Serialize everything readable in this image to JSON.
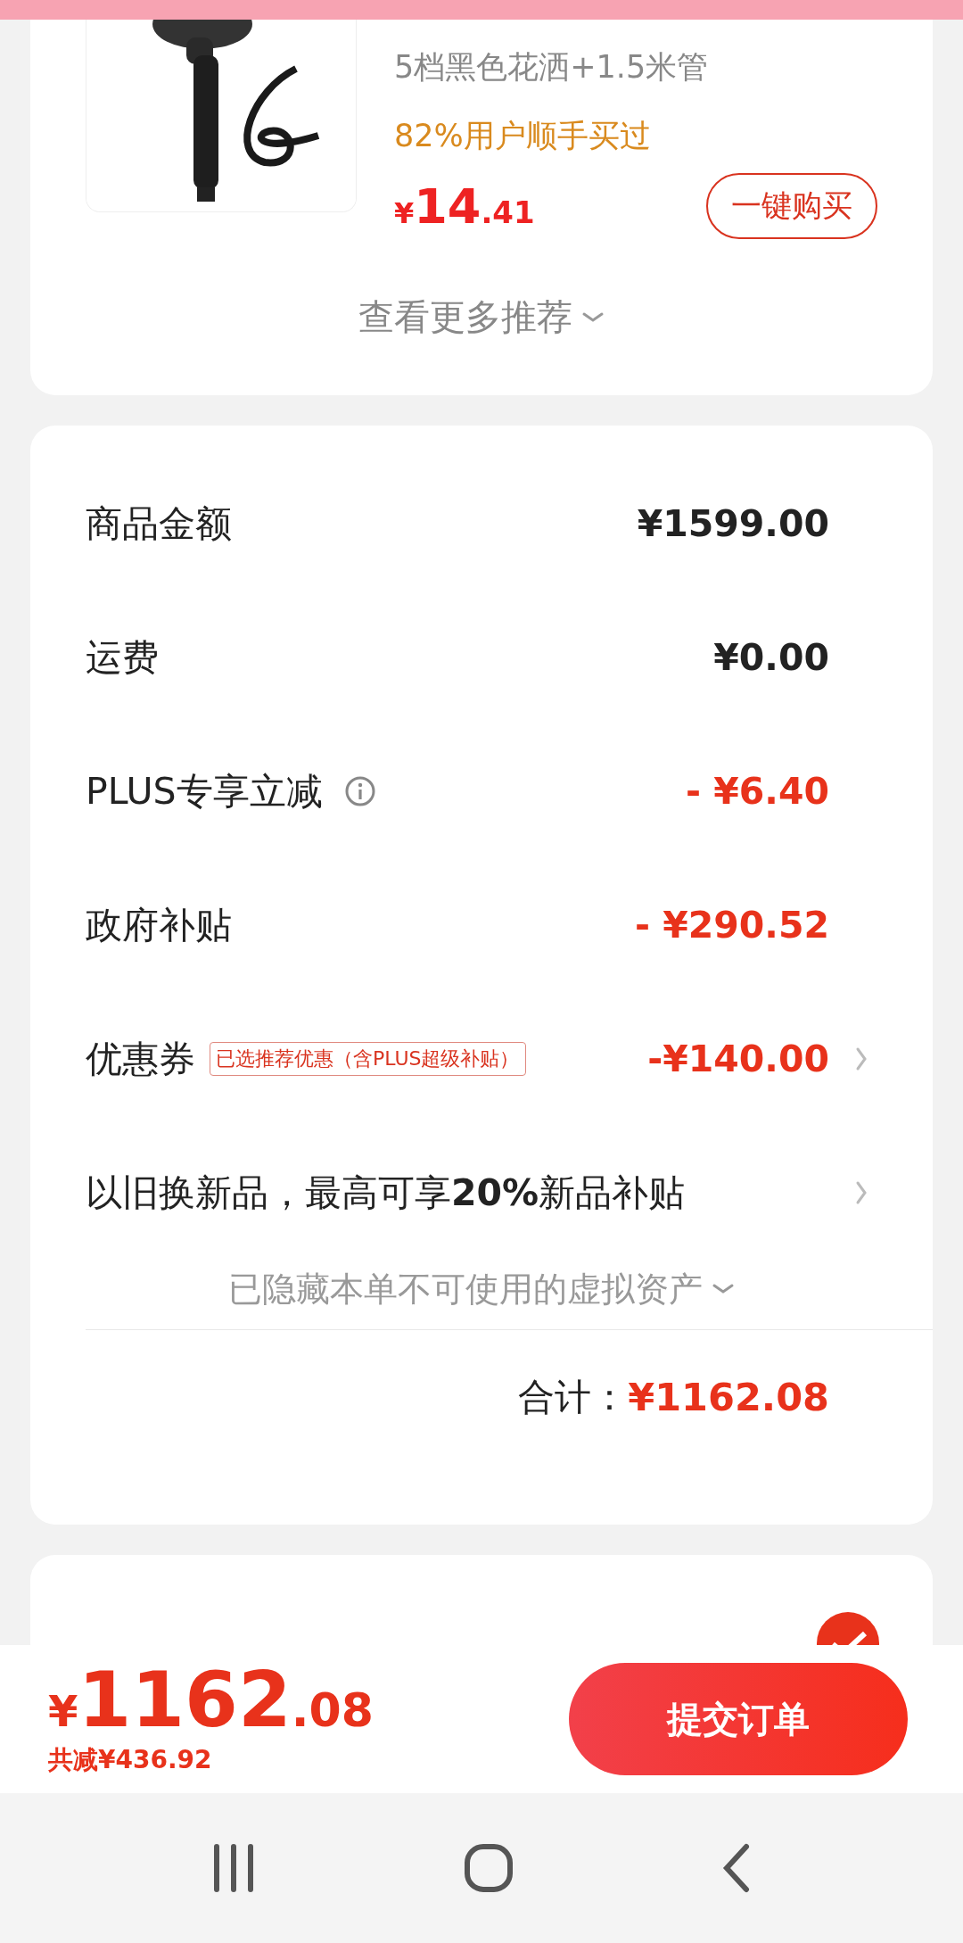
{
  "top_product": {
    "title": "5档黑色花洒+1.5米管",
    "social_proof": "82%用户顺手买过",
    "price_currency": "¥",
    "price_int": "14",
    "price_dec": ".41",
    "buy_button": "一键购买"
  },
  "more_link": "查看更多推荐",
  "summary_rows": [
    {
      "kind": "amount",
      "label": "商品金额",
      "value": "¥1599.00",
      "discount": false
    },
    {
      "kind": "amount",
      "label": "运费",
      "value": "¥0.00",
      "discount": false
    },
    {
      "kind": "info",
      "label": "PLUS专享立减",
      "value": "- ¥6.40",
      "discount": true
    },
    {
      "kind": "amount",
      "label": "政府补贴",
      "value": "- ¥290.52",
      "discount": true
    },
    {
      "kind": "coupon",
      "label": "优惠券",
      "tag": "已选推荐优惠（含PLUS超级补贴）",
      "value": "-¥140.00",
      "discount": true
    },
    {
      "kind": "trade_in",
      "label": "以旧换新",
      "value": "品，最高可享**20%**新品补贴",
      "discount": false
    }
  ],
  "hidden_assets": "已隐藏本单不可使用的虚拟资产",
  "total": {
    "label": "合计：",
    "value": "¥1162.08"
  },
  "payment": {
    "selected": true
  },
  "bottom_bar": {
    "currency": "¥",
    "amount_int": "1162",
    "amount_dec": ".08",
    "saved": "共减¥436.92",
    "submit": "提交订单"
  }
}
